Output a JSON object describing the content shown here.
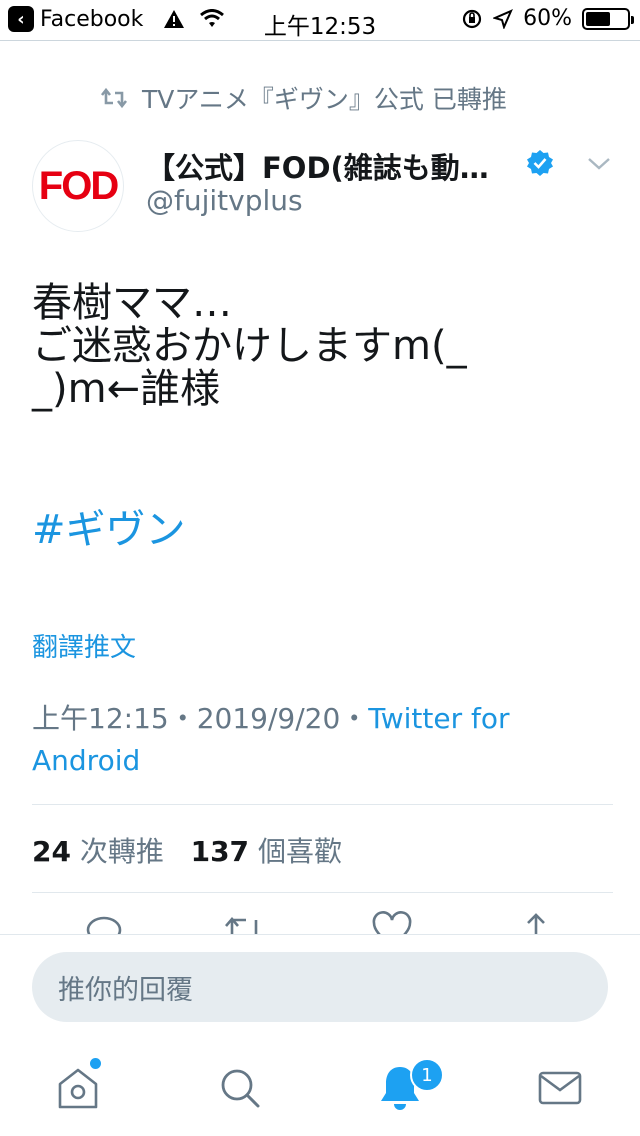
{
  "status_bar": {
    "back_app": "Facebook",
    "time": "上午12:53",
    "battery_text": "60%",
    "battery_level": 0.6
  },
  "tweet": {
    "retweeted_by": "TVアニメ『ギヴン』公式 已轉推",
    "author_name": "【公式】FOD(雑誌も動…",
    "author_handle": "@fujitvplus",
    "avatar_logo": "FOD",
    "text_lines": [
      "春樹ママ…",
      "ご迷惑おかけしますm(_",
      "_)m←誰様"
    ],
    "hashtag": "#ギヴン",
    "translate_label": "翻譯推文",
    "timestamp": "上午12:15・2019/9/20・",
    "source_part1": "Twitter for",
    "source_part2": "Android",
    "retweet_count": "24",
    "retweet_label": "次轉推",
    "like_count": "137",
    "like_label": "個喜歡"
  },
  "reply": {
    "placeholder": "推你的回覆"
  },
  "tabs": [
    {
      "name": "home",
      "icon": "home-icon"
    },
    {
      "name": "search",
      "icon": "search-icon"
    },
    {
      "name": "notifications",
      "icon": "bell-icon",
      "badge": "1"
    },
    {
      "name": "messages",
      "icon": "mail-icon"
    }
  ],
  "colors": {
    "accent": "#1da1f2",
    "link": "#1b95e0",
    "secondary_text": "#657786",
    "brand_fod_red": "#e60012"
  }
}
